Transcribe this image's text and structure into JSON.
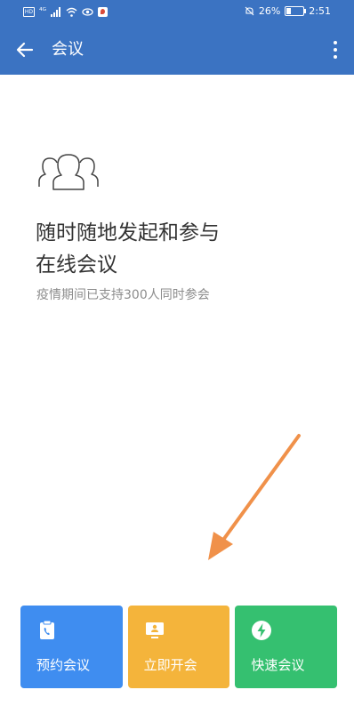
{
  "status_bar": {
    "left_glyphs": [
      "HD",
      "4G",
      "signal",
      "wifi",
      "eye",
      "app"
    ],
    "silent_icon": "bell-off-icon",
    "battery_percent": "26%",
    "battery_level": 0.26,
    "time": "2:51"
  },
  "app_bar": {
    "title": "会议",
    "back_icon": "arrow-left-icon",
    "menu_icon": "more-vertical-icon",
    "color": "#3b73c2"
  },
  "hero": {
    "icon": "people-group-icon",
    "headline_line1": "随时随地发起和参与",
    "headline_line2": "在线会议",
    "subline": "疫情期间已支持300人同时参会"
  },
  "annotation": {
    "icon": "orange-arrow-annotation",
    "color": "#f0914a"
  },
  "actions": [
    {
      "label": "预约会议",
      "icon": "clipboard-phone-icon",
      "color": "#3f8df0"
    },
    {
      "label": "立即开会",
      "icon": "monitor-person-icon",
      "color": "#f4b43b"
    },
    {
      "label": "快速会议",
      "icon": "lightning-icon",
      "color": "#35c070"
    }
  ]
}
